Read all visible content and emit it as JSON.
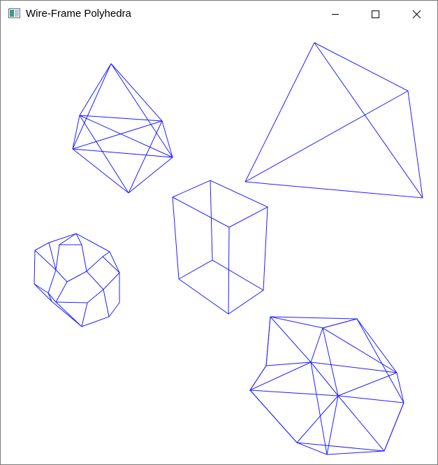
{
  "window": {
    "title": "Wire-Frame Polyhedra",
    "app_icon": "app-window-icon",
    "controls": {
      "minimize_icon": "minimize-icon",
      "maximize_icon": "maximize-icon",
      "close_icon": "close-icon"
    }
  },
  "scene": {
    "stroke_color": "#1f1fff",
    "background_color": "#ffffff",
    "shapes": [
      "octahedron",
      "tetrahedron",
      "cube",
      "dodecahedron",
      "icosahedron"
    ]
  }
}
